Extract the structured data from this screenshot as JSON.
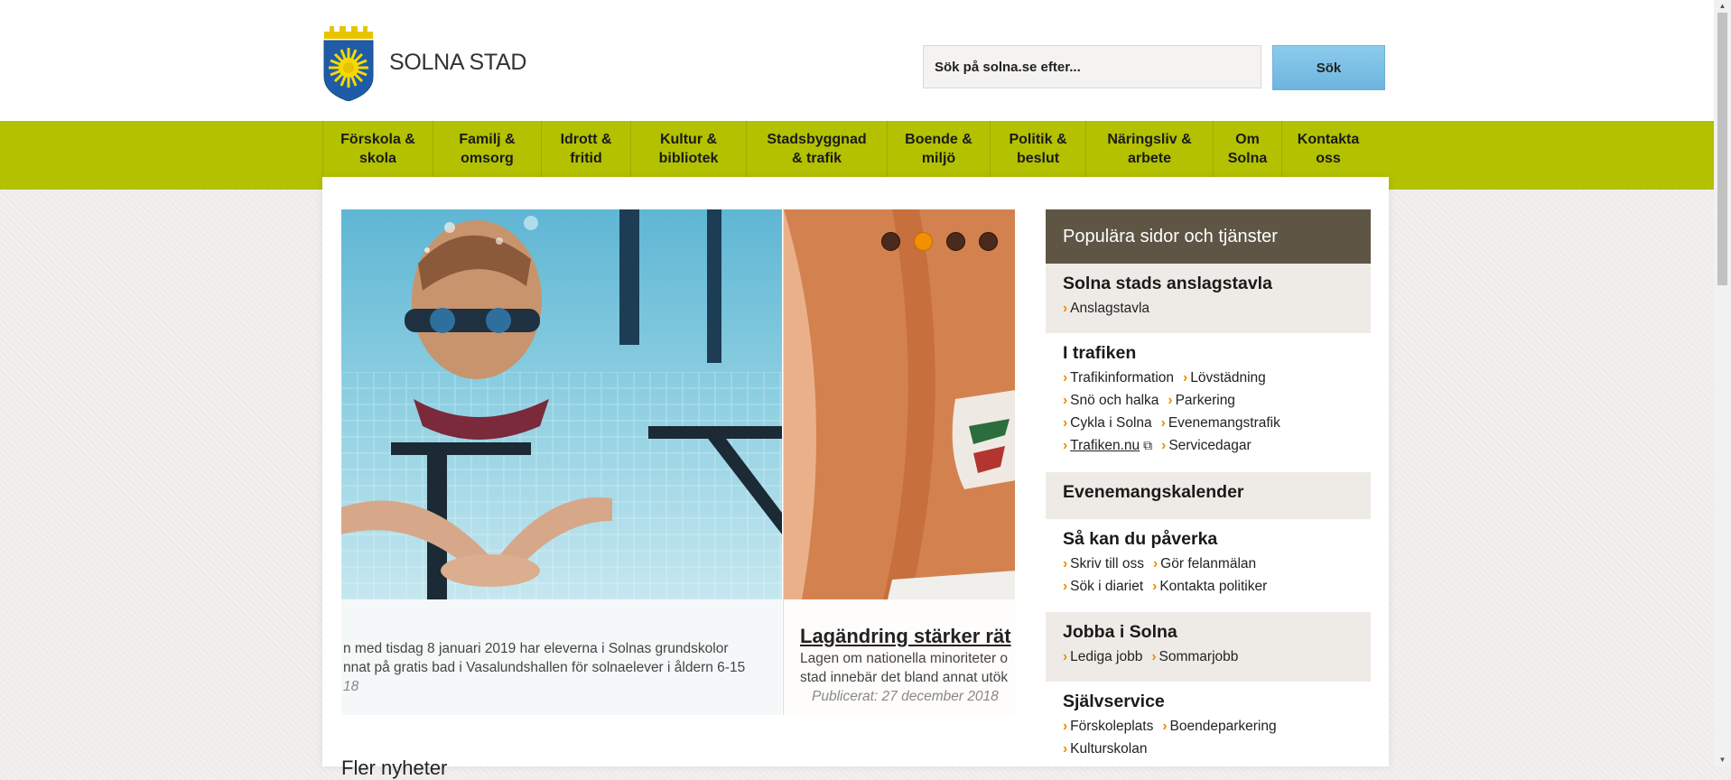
{
  "header": {
    "site_name": "SOLNA STAD",
    "search_placeholder": "Sök på solna.se efter...",
    "search_button": "Sök"
  },
  "nav": [
    {
      "label": "Förskola & skola"
    },
    {
      "label": "Familj & omsorg"
    },
    {
      "label": "Idrott & fritid"
    },
    {
      "label": "Kultur & bibliotek"
    },
    {
      "label": "Stadsbyggnad & trafik"
    },
    {
      "label": "Boende & miljö"
    },
    {
      "label": "Politik & beslut"
    },
    {
      "label": "Näringsliv & arbete"
    },
    {
      "label": "Om Solna"
    },
    {
      "label": "Kontakta oss"
    }
  ],
  "slider": {
    "slide1": {
      "line1": "n med tisdag 8 januari 2019 har eleverna i Solnas grundskolor",
      "line2": "nnat på gratis bad i Vasalundshallen för solnaelever i åldern 6-15",
      "date": "18"
    },
    "slide2": {
      "title": "Lagändring stärker rät",
      "line1": "Lagen om nationella minoriteter o",
      "line2": "stad innebär det bland annat utök",
      "date": "Publicerat: 27 december 2018"
    },
    "active_dot": 2
  },
  "news_heading": "Fler nyheter",
  "sidebar": {
    "header": "Populära sidor och tjänster",
    "sections": [
      {
        "title": "Solna stads anslagstavla",
        "links": [
          "Anslagstavla"
        ]
      },
      {
        "title": "I trafiken",
        "links": [
          "Trafikinformation",
          "Lövstädning",
          "Snö och halka",
          "Parkering",
          "Cykla i Solna",
          "Evenemangstrafik",
          "Trafiken.nu",
          "Servicedagar"
        ]
      },
      {
        "title": "Evenemangskalender",
        "links": []
      },
      {
        "title": "Så kan du påverka",
        "links": [
          "Skriv till oss",
          "Gör felanmälan",
          "Sök i diariet",
          "Kontakta politiker"
        ]
      },
      {
        "title": "Jobba i Solna",
        "links": [
          "Lediga jobb",
          "Sommarjobb"
        ]
      },
      {
        "title": "Självservice",
        "links": [
          "Förskoleplats",
          "Boendeparkering",
          "Kulturskolan"
        ]
      }
    ]
  },
  "colors": {
    "nav_bg": "#b3c100",
    "sidebar_header": "#5e5545",
    "accent_orange": "#f19000",
    "button_blue": "#7fc1e6"
  }
}
